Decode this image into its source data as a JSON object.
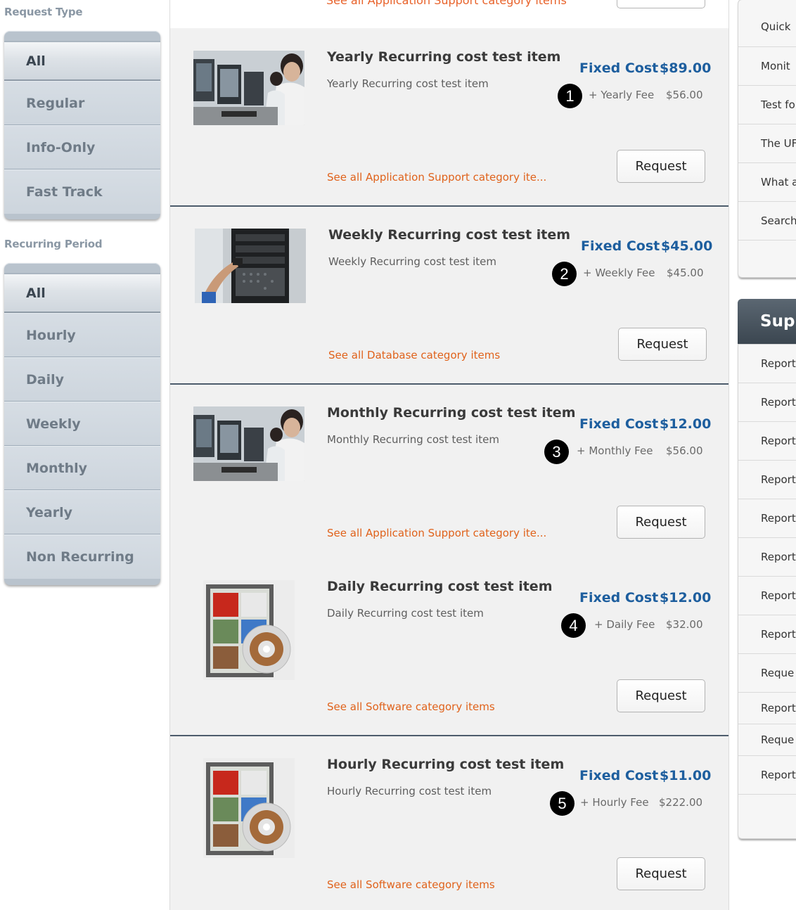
{
  "filters": {
    "request_type": {
      "heading": "Request Type",
      "options": [
        "All",
        "Regular",
        "Info-Only",
        "Fast Track"
      ],
      "selected": "All"
    },
    "recurring_period": {
      "heading": "Recurring Period",
      "options": [
        "All",
        "Hourly",
        "Daily",
        "Weekly",
        "Monthly",
        "Yearly",
        "Non Recurring"
      ],
      "selected": "All"
    }
  },
  "top_partial": {
    "link": "See all Application Support category items"
  },
  "items": [
    {
      "number": "1",
      "title": "Yearly Recurring cost  test item",
      "description": "Yearly Recurring cost  test item",
      "price_label": "Fixed Cost",
      "price": "$89.00",
      "fee_label": "+ Yearly Fee",
      "fee_amount": "$56.00",
      "category_link": "See all Application Support category ite...",
      "request_label": "Request",
      "image": "call-center-photo"
    },
    {
      "number": "2",
      "title": "Weekly Recurring cost  test item",
      "description": "Weekly Recurring cost  test item",
      "price_label": "Fixed Cost",
      "price": "$45.00",
      "fee_label": "+ Weekly Fee",
      "fee_amount": "$45.00",
      "category_link": "See all Database category items",
      "request_label": "Request",
      "image": "server-rack-photo"
    },
    {
      "number": "3",
      "title": "Monthly Recurring cost  test item",
      "description": "Monthly Recurring cost  test item",
      "price_label": "Fixed Cost",
      "price": "$12.00",
      "fee_label": "+ Monthly Fee",
      "fee_amount": "$56.00",
      "category_link": "See all Application Support category ite...",
      "request_label": "Request",
      "image": "call-center-photo"
    },
    {
      "number": "4",
      "title": "Daily Recurring cost  test item",
      "description": "Daily Recurring cost  test item",
      "price_label": "Fixed Cost",
      "price": "$12.00",
      "fee_label": "+ Daily Fee",
      "fee_amount": "$32.00",
      "category_link": "See all Software category items",
      "request_label": "Request",
      "image": "software-box-photo"
    },
    {
      "number": "5",
      "title": "Hourly Recurring cost  test item",
      "description": "Hourly Recurring cost  test item",
      "price_label": "Fixed Cost",
      "price": "$11.00",
      "fee_label": "+ Hourly Fee",
      "fee_amount": "$222.00",
      "category_link": "See all Software category items",
      "request_label": "Request",
      "image": "software-box-photo"
    }
  ],
  "right_sidebar": {
    "quick_links": [
      "Quick",
      "Monit",
      "Test fo",
      "The UF",
      "What a",
      "Search",
      ""
    ],
    "support_header": "Supp",
    "support_links": [
      "Report",
      "Report",
      "Report",
      "Report",
      "Report",
      "Report",
      "Report",
      "Report",
      "Reque",
      "Report",
      "Reque",
      "Report",
      ""
    ]
  },
  "colors": {
    "price_blue": "#1d5e9e",
    "link_orange": "#e0621b",
    "filter_bg": "#b9c3cd",
    "support_header_bg": "#4a5560"
  }
}
